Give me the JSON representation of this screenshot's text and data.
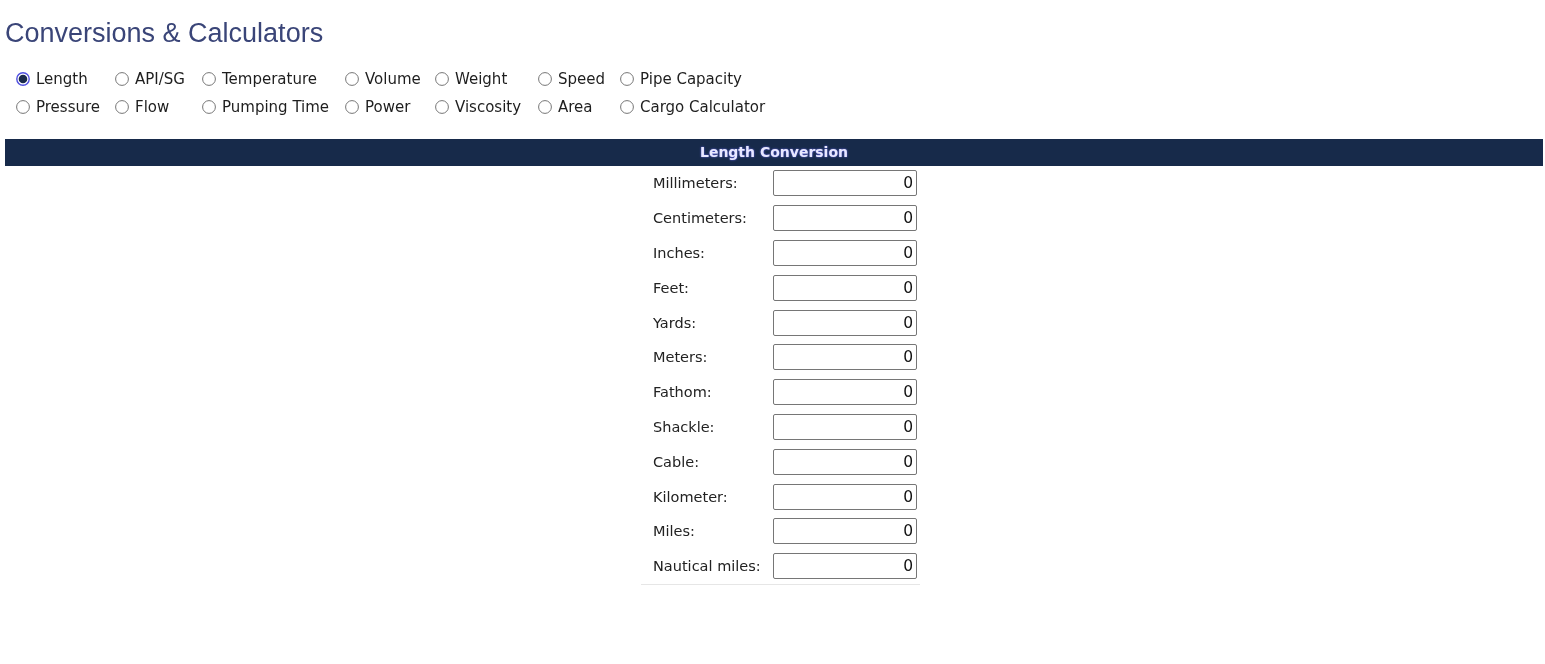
{
  "title": "Conversions & Calculators",
  "options": [
    {
      "label": "Length",
      "selected": true
    },
    {
      "label": "API/SG",
      "selected": false
    },
    {
      "label": "Temperature",
      "selected": false
    },
    {
      "label": "Volume",
      "selected": false
    },
    {
      "label": "Weight",
      "selected": false
    },
    {
      "label": "Speed",
      "selected": false
    },
    {
      "label": "Pipe Capacity",
      "selected": false
    },
    {
      "label": "Pressure",
      "selected": false
    },
    {
      "label": "Flow",
      "selected": false
    },
    {
      "label": "Pumping Time",
      "selected": false
    },
    {
      "label": "Power",
      "selected": false
    },
    {
      "label": "Viscosity",
      "selected": false
    },
    {
      "label": "Area",
      "selected": false
    },
    {
      "label": "Cargo Calculator",
      "selected": false
    }
  ],
  "conversion": {
    "title": "Length Conversion",
    "fields": [
      {
        "label": "Millimeters:",
        "value": "0"
      },
      {
        "label": "Centimeters:",
        "value": "0"
      },
      {
        "label": "Inches:",
        "value": "0"
      },
      {
        "label": "Feet:",
        "value": "0"
      },
      {
        "label": "Yards:",
        "value": "0"
      },
      {
        "label": "Meters:",
        "value": "0"
      },
      {
        "label": "Fathom:",
        "value": "0"
      },
      {
        "label": "Shackle:",
        "value": "0"
      },
      {
        "label": "Cable:",
        "value": "0"
      },
      {
        "label": "Kilometer:",
        "value": "0"
      },
      {
        "label": "Miles:",
        "value": "0"
      },
      {
        "label": "Nautical miles:",
        "value": "0"
      }
    ]
  }
}
